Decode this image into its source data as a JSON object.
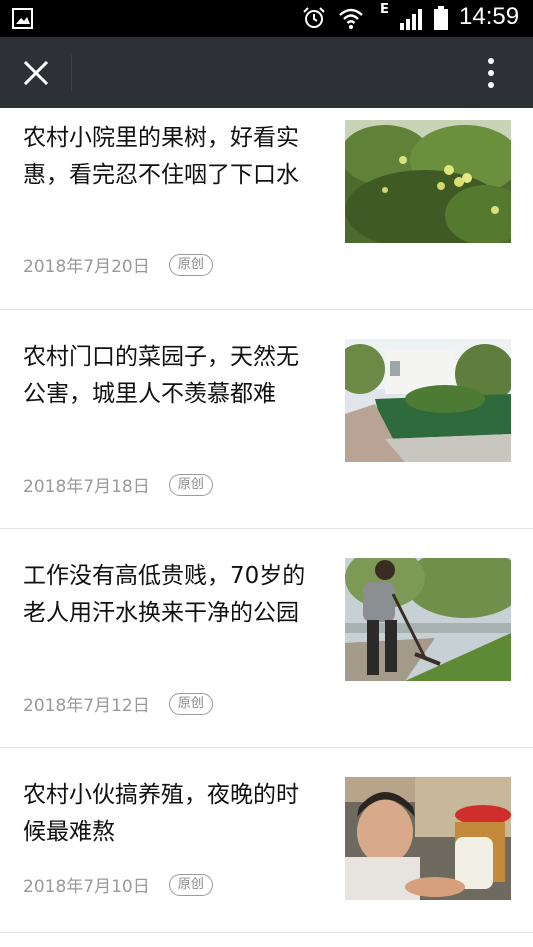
{
  "status_bar": {
    "network_type": "E",
    "time": "14:59"
  },
  "nav": {
    "close_icon": "close-icon",
    "more_icon": "more-vertical-icon"
  },
  "articles": [
    {
      "title": "农村小院里的果树，好看实惠，看完忍不住咽了下口水",
      "date": "2018年7月20日",
      "badge": "原创",
      "image": "apple-tree-photo"
    },
    {
      "title": "农村门口的菜园子，天然无公害，城里人不羡慕都难",
      "date": "2018年7月18日",
      "badge": "原创",
      "image": "vegetable-garden-photo"
    },
    {
      "title": "工作没有高低贵贱，70岁的老人用汗水换来干净的公园",
      "date": "2018年7月12日",
      "badge": "原创",
      "image": "old-man-raking-park-photo"
    },
    {
      "title": "农村小伙搞养殖，夜晚的时候最难熬",
      "date": "2018年7月10日",
      "badge": "原创",
      "image": "young-farmer-photo"
    }
  ],
  "colors": {
    "status_bar_bg": "#000000",
    "nav_bg": "#2d3035",
    "title_text": "#111111",
    "meta_text": "#999999"
  }
}
